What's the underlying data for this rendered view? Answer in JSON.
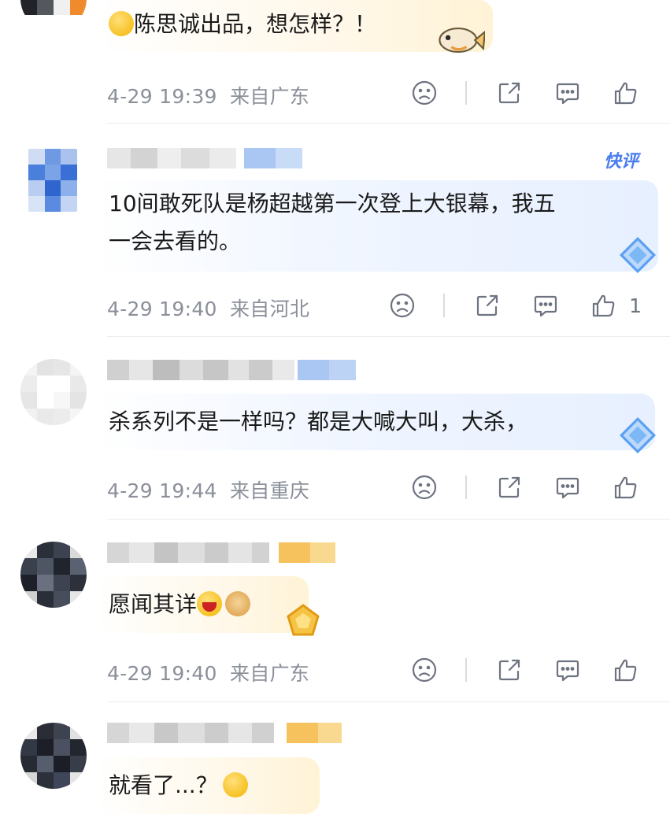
{
  "comments": [
    {
      "text": "陈思诚出品，想怎样？！",
      "time": "4-29 19:39",
      "location": "来自广东",
      "likes": ""
    },
    {
      "badge": "快评",
      "text_line1": "10间敢死队是杨超越第一次登上大银幕，我五",
      "text_line2": "一会去看的。",
      "time": "4-29 19:40",
      "location": "来自河北",
      "likes": "1"
    },
    {
      "text": "杀系列不是一样吗？都是大喊大叫，大杀，",
      "time": "4-29 19:44",
      "location": "来自重庆",
      "likes": ""
    },
    {
      "text": "愿闻其详",
      "time": "4-29 19:40",
      "location": "来自广东",
      "likes": ""
    },
    {
      "text": "就看了...？"
    }
  ],
  "icons": {
    "dislike": "frown-face-icon",
    "share": "share-icon",
    "comment": "comment-icon",
    "like": "thumbs-up-icon"
  },
  "colors": {
    "meta_text": "#8a8f99",
    "icon_stroke": "#6e7380",
    "badge_blue": "#4a7df0"
  }
}
